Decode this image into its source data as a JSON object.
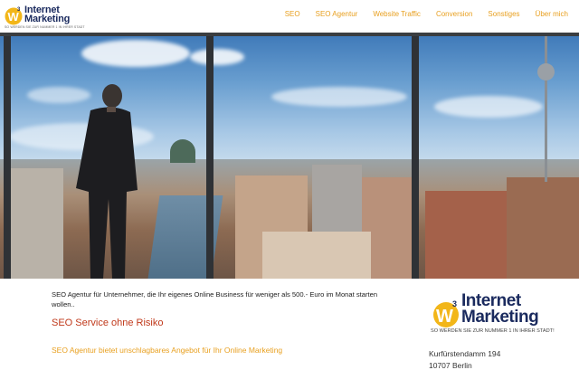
{
  "header": {
    "logo": {
      "line1": "Internet",
      "line2": "Marketing",
      "tagline": "SO WERDEN SIE ZUR NUMMER 1 IN IHRER STADT"
    },
    "nav": [
      "SEO",
      "SEO Agentur",
      "Website Traffic",
      "Conversion",
      "Sonstiges",
      "Über mich"
    ]
  },
  "hero": {
    "image_subject": "Berlin skyline"
  },
  "main": {
    "intro": "SEO Agentur für Unternehmer, die Ihr eigenes Online Business für weniger als 500.- Euro im Monat starten wollen..",
    "heading": "SEO Service ohne Risiko",
    "subheading": "SEO Agentur bietet unschlagbares Angebot für Ihr Online Marketing"
  },
  "sidebar": {
    "logo": {
      "line1": "Internet",
      "line2": "Marketing",
      "tagline": "SO WERDEN SIE ZUR NUMMER 1 IN IHRER STADT!"
    },
    "address_line1": "Kurfürstendamm 194",
    "address_line2": "10707 Berlin"
  },
  "colors": {
    "accent": "#e8a020",
    "heading": "#c0391b",
    "brand_navy": "#1a2a5e"
  }
}
